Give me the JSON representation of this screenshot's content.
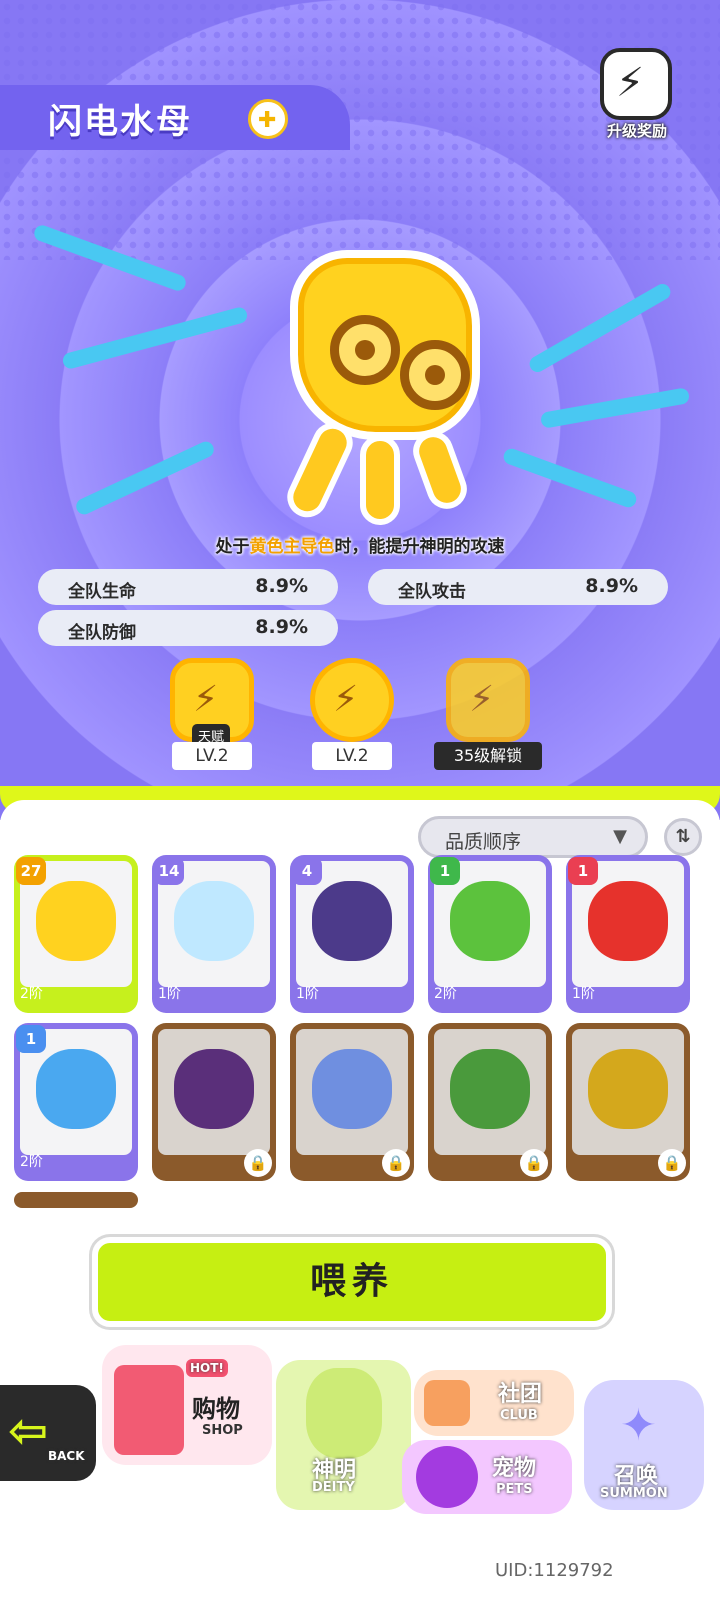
{
  "header": {
    "pet_name": "闪电水母",
    "badge_icon": "cross-badge-icon",
    "reward_label": "升级奖励"
  },
  "description": {
    "prefix": "处于",
    "highlight": "黄色主导色",
    "suffix": "时，能提升神明的攻速"
  },
  "stats": [
    {
      "name": "全队生命",
      "value": "8.9%"
    },
    {
      "name": "全队攻击",
      "value": "8.9%"
    },
    {
      "name": "全队防御",
      "value": "8.9%"
    }
  ],
  "skills": [
    {
      "tag": "天赋",
      "level": "LV.2"
    },
    {
      "level": "LV.2"
    },
    {
      "level": "35级解锁"
    }
  ],
  "sort": {
    "label": "品质顺序"
  },
  "pets": [
    {
      "level": "27",
      "rank": "2阶",
      "color": "#ffd21f",
      "locked": false
    },
    {
      "level": "14",
      "rank": "1阶",
      "color": "#bfe8ff",
      "locked": false
    },
    {
      "level": "4",
      "rank": "1阶",
      "color": "#4c3a8a",
      "locked": false
    },
    {
      "level": "1",
      "rank": "2阶",
      "color": "#5cc23d",
      "locked": false
    },
    {
      "level": "1",
      "rank": "1阶",
      "color": "#e6322c",
      "locked": false
    },
    {
      "level": "1",
      "rank": "2阶",
      "color": "#4aa8f0",
      "locked": false
    },
    {
      "color": "#5a2f7a",
      "locked": true
    },
    {
      "color": "#6f8fe0",
      "locked": true
    },
    {
      "color": "#4a9a3c",
      "locked": true
    },
    {
      "color": "#d4a81c",
      "locked": true
    }
  ],
  "feed_button": "喂养",
  "nav": {
    "back": "BACK",
    "shop_cn": "购物",
    "shop_en": "SHOP",
    "shop_hot": "HOT!",
    "deity_cn": "神明",
    "deity_en": "DEITY",
    "club_cn": "社团",
    "club_en": "CLUB",
    "pets_cn": "宠物",
    "pets_en": "PETS",
    "summon_cn": "召唤",
    "summon_en": "SUMMON"
  },
  "uid": "UID:1129792"
}
